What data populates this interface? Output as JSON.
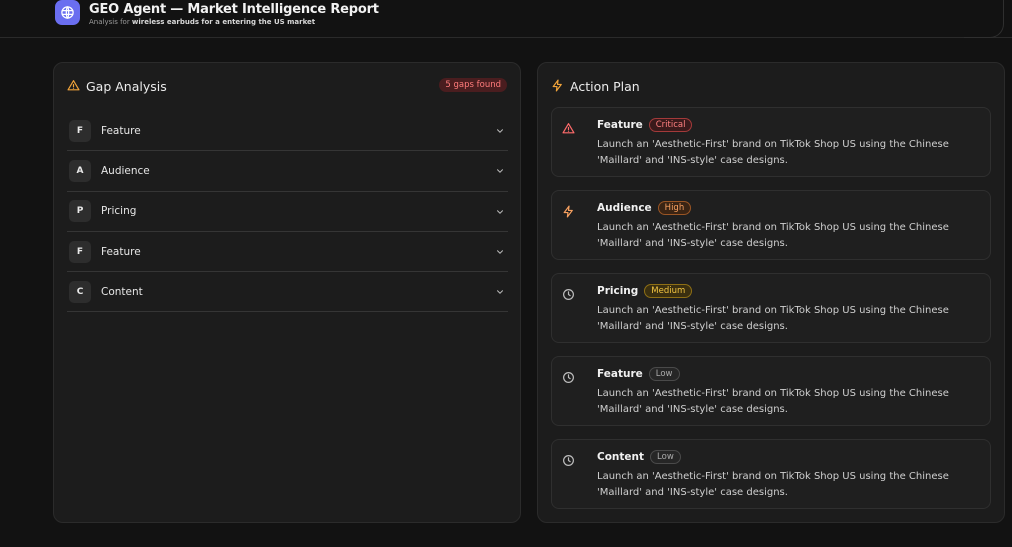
{
  "header": {
    "title": "GEO Agent — Market Intelligence Report",
    "subtitle_prefix": "Analysis for ",
    "subtitle_bold": "wireless earbuds for a entering the US market",
    "logo_icon": "globe-icon",
    "accent": "#6a6ef0"
  },
  "gap_analysis": {
    "title": "Gap Analysis",
    "icon": "warning-triangle-icon",
    "badge": "5 gaps found",
    "items": [
      {
        "letter": "F",
        "label": "Feature"
      },
      {
        "letter": "A",
        "label": "Audience"
      },
      {
        "letter": "P",
        "label": "Pricing"
      },
      {
        "letter": "F",
        "label": "Feature"
      },
      {
        "letter": "C",
        "label": "Content"
      }
    ]
  },
  "action_plan": {
    "title": "Action Plan",
    "icon": "lightning-icon",
    "items": [
      {
        "title": "Feature",
        "priority": "Critical",
        "icon": "alert-triangle-icon",
        "desc": "Launch an 'Aesthetic-First' brand on TikTok Shop US using the Chinese 'Maillard' and 'INS-style' case designs."
      },
      {
        "title": "Audience",
        "priority": "High",
        "icon": "lightning-icon",
        "desc": "Launch an 'Aesthetic-First' brand on TikTok Shop US using the Chinese 'Maillard' and 'INS-style' case designs."
      },
      {
        "title": "Pricing",
        "priority": "Medium",
        "icon": "clock-icon",
        "desc": "Launch an 'Aesthetic-First' brand on TikTok Shop US using the Chinese 'Maillard' and 'INS-style' case designs."
      },
      {
        "title": "Feature",
        "priority": "Low",
        "icon": "clock-icon",
        "desc": "Launch an 'Aesthetic-First' brand on TikTok Shop US using the Chinese 'Maillard' and 'INS-style' case designs."
      },
      {
        "title": "Content",
        "priority": "Low",
        "icon": "clock-icon",
        "desc": "Launch an 'Aesthetic-First' brand on TikTok Shop US using the Chinese 'Maillard' and 'INS-style' case designs."
      }
    ]
  },
  "colors": {
    "critical": "#ff8080",
    "high": "#f7a060",
    "medium": "#f3c542",
    "low": "#aaaaaa"
  }
}
